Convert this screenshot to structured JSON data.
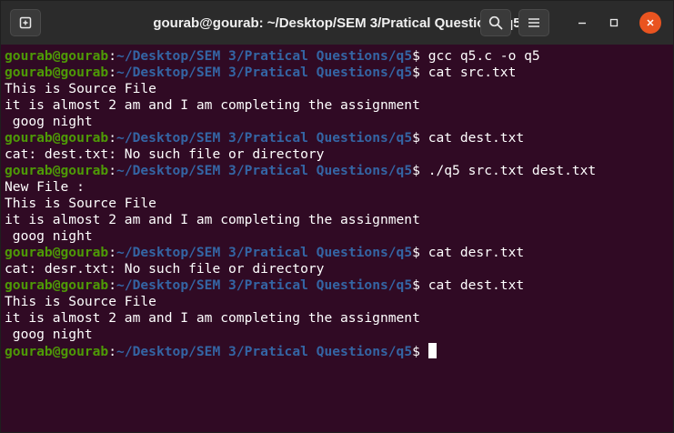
{
  "window": {
    "title": "gourab@gourab: ~/Desktop/SEM 3/Pratical Questions/q5"
  },
  "icons": {
    "new_tab": "new-tab-icon",
    "search": "search-icon",
    "menu": "hamburger-menu-icon",
    "minimize": "minimize-icon",
    "maximize": "maximize-icon",
    "close": "close-icon"
  },
  "colors": {
    "background": "#300a24",
    "user": "#4e9a06",
    "path": "#3465a4",
    "close_button": "#e95420"
  },
  "prompt": {
    "user": "gourab@gourab",
    "colon": ":",
    "path": "~/Desktop/SEM 3/Pratical Questions/q5",
    "symbol": "$ "
  },
  "lines": [
    {
      "type": "prompt",
      "text": "gcc q5.c -o q5"
    },
    {
      "type": "prompt",
      "text": "cat src.txt"
    },
    {
      "type": "output",
      "text": "This is Source File"
    },
    {
      "type": "output",
      "text": "it is almost 2 am and I am completing the assignment"
    },
    {
      "type": "output",
      "text": " goog night"
    },
    {
      "type": "prompt",
      "text": "cat dest.txt"
    },
    {
      "type": "output",
      "text": "cat: dest.txt: No such file or directory"
    },
    {
      "type": "prompt",
      "text": "./q5 src.txt dest.txt"
    },
    {
      "type": "output",
      "text": "New File :"
    },
    {
      "type": "output",
      "text": "This is Source File"
    },
    {
      "type": "output",
      "text": "it is almost 2 am and I am completing the assignment"
    },
    {
      "type": "output",
      "text": " goog night"
    },
    {
      "type": "prompt",
      "text": "cat desr.txt"
    },
    {
      "type": "output",
      "text": "cat: desr.txt: No such file or directory"
    },
    {
      "type": "prompt",
      "text": "cat dest.txt"
    },
    {
      "type": "output",
      "text": "This is Source File"
    },
    {
      "type": "output",
      "text": "it is almost 2 am and I am completing the assignment"
    },
    {
      "type": "output",
      "text": " goog night"
    },
    {
      "type": "prompt",
      "text": ""
    }
  ]
}
